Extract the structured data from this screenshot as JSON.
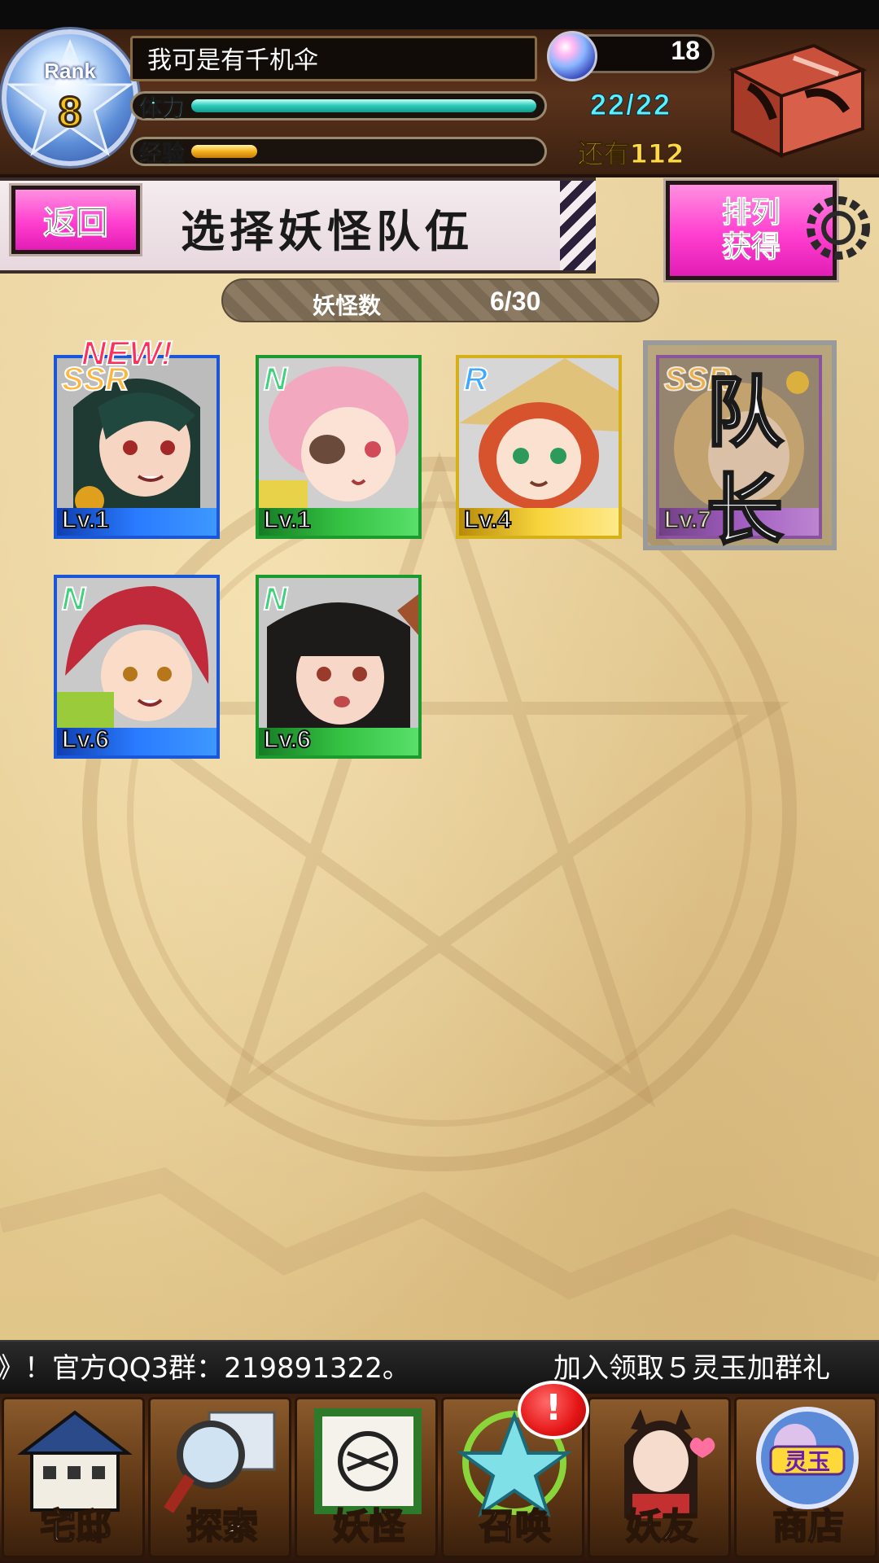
{
  "header": {
    "rank_label": "Rank",
    "rank_value": "8",
    "player_name": "我可是有千机伞",
    "gem_count": "18",
    "stamina_label": "体力",
    "stamina_value": "22/22",
    "stamina_fraction": 1.0,
    "exp_label": "经验",
    "exp_value": "还有112",
    "exp_fraction": 0.19,
    "icons": {
      "gem": "spirit-orb-icon",
      "chest": "treasure-chest-icon",
      "rank": "pentagram-badge-icon"
    }
  },
  "title_bar": {
    "back_label": "返回",
    "title": "选择妖怪队伍",
    "sort_line1": "排列",
    "sort_line2": "获得"
  },
  "monster_count": {
    "label": "妖怪数",
    "value": "6/30"
  },
  "cards": [
    {
      "rarity": "SSR",
      "level": "Lv.1",
      "frame": "blue",
      "badge": "NEW!",
      "leader": false
    },
    {
      "rarity": "N",
      "level": "Lv.1",
      "frame": "green",
      "badge": "",
      "leader": false
    },
    {
      "rarity": "R",
      "level": "Lv.4",
      "frame": "gold",
      "badge": "",
      "leader": false
    },
    {
      "rarity": "SSR",
      "level": "Lv.7",
      "frame": "purple",
      "badge": "",
      "leader": true,
      "leader_text": "队长"
    },
    {
      "rarity": "N",
      "level": "Lv.6",
      "frame": "blue",
      "badge": "",
      "leader": false
    },
    {
      "rarity": "N",
      "level": "Lv.6",
      "frame": "green",
      "badge": "",
      "leader": false
    }
  ],
  "ticker": {
    "text": "》！官方QQ3群：219891322。",
    "text2": "加入领取５灵玉加群礼"
  },
  "nav": [
    {
      "label": "宅邸",
      "icon": "mansion-icon"
    },
    {
      "label": "探索",
      "icon": "magnifier-map-icon"
    },
    {
      "label": "妖怪",
      "icon": "scroll-icon"
    },
    {
      "label": "召唤",
      "icon": "pentagram-icon"
    },
    {
      "label": "妖友",
      "icon": "friend-girl-icon"
    },
    {
      "label": "商店",
      "icon": "orb-shop-icon",
      "badge": "灵玉"
    }
  ],
  "alert_badge": "!",
  "colors": {
    "stamina": "#28c9b8",
    "exp": "#f5b11b",
    "pink_button": "#ff3fcf",
    "header_bg": "#4a2a17"
  }
}
